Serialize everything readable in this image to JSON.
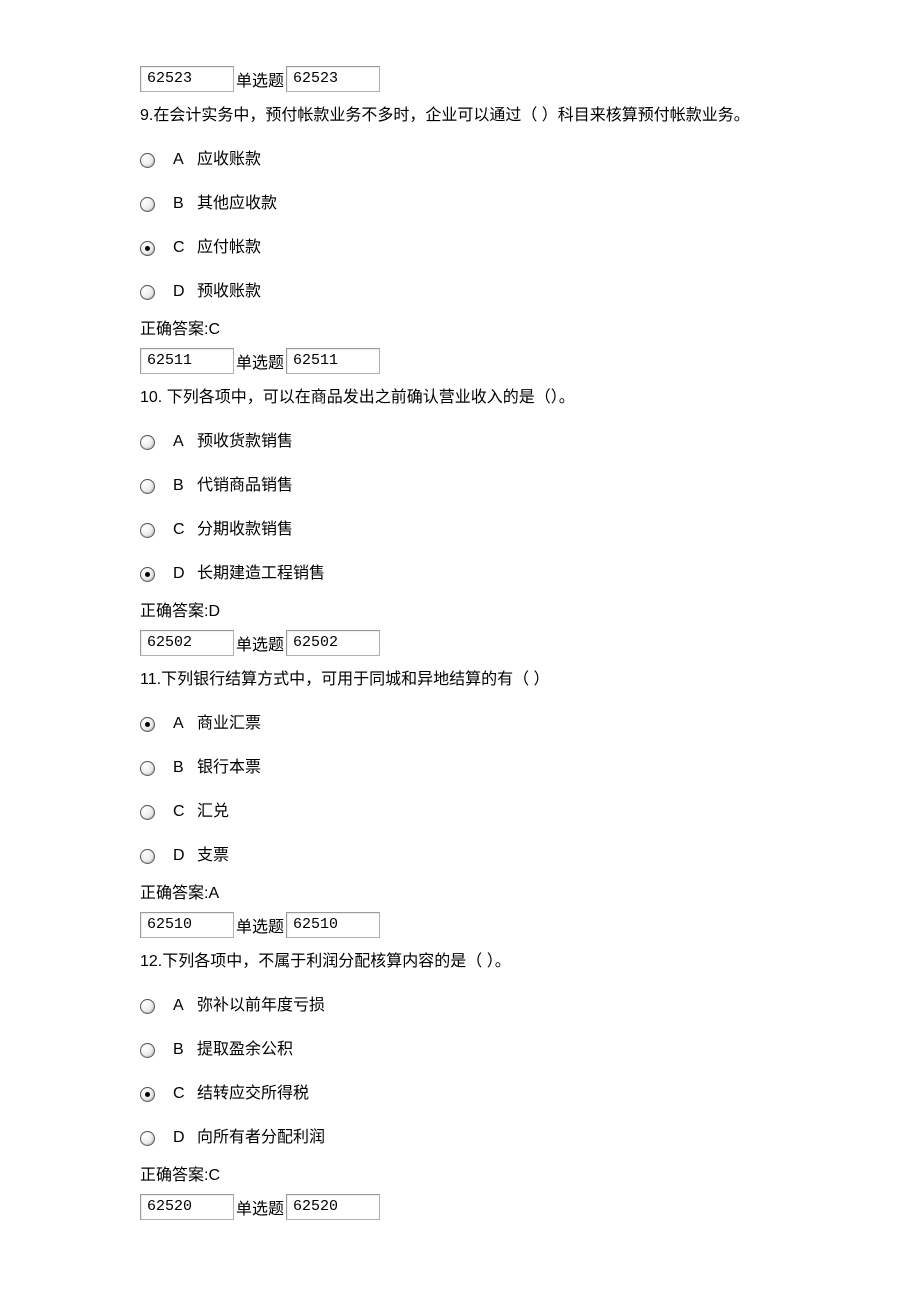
{
  "qtype_label": "单选题",
  "questions": [
    {
      "id1": "62523",
      "id2": "62523",
      "num": "9.",
      "stem": "在会计实务中，预付帐款业务不多时，企业可以通过（ ）科目来核算预付帐款业务。",
      "options": [
        {
          "label": "A",
          "text": "应收账款",
          "selected": false
        },
        {
          "label": "B",
          "text": "其他应收款",
          "selected": false
        },
        {
          "label": "C",
          "text": "应付帐款",
          "selected": true
        },
        {
          "label": "D",
          "text": "预收账款",
          "selected": false
        }
      ],
      "answer": "正确答案:C"
    },
    {
      "id1": "62511",
      "id2": "62511",
      "num": "10.",
      "stem": " 下列各项中，可以在商品发出之前确认营业收入的是（）。",
      "options": [
        {
          "label": "A",
          "text": "预收货款销售",
          "selected": false
        },
        {
          "label": "B",
          "text": "代销商品销售",
          "selected": false
        },
        {
          "label": "C",
          "text": "分期收款销售",
          "selected": false
        },
        {
          "label": "D",
          "text": "长期建造工程销售",
          "selected": true
        }
      ],
      "answer": "正确答案:D"
    },
    {
      "id1": "62502",
      "id2": "62502",
      "num": "11.",
      "stem": "下列银行结算方式中，可用于同城和异地结算的有（ ）",
      "options": [
        {
          "label": "A",
          "text": "商业汇票",
          "selected": true
        },
        {
          "label": "B",
          "text": "银行本票",
          "selected": false
        },
        {
          "label": "C",
          "text": "汇兑",
          "selected": false
        },
        {
          "label": "D",
          "text": "支票",
          "selected": false
        }
      ],
      "answer": "正确答案:A"
    },
    {
      "id1": "62510",
      "id2": "62510",
      "num": "12.",
      "stem": "下列各项中，不属于利润分配核算内容的是（ ）。",
      "options": [
        {
          "label": "A",
          "text": "弥补以前年度亏损",
          "selected": false
        },
        {
          "label": "B",
          "text": "提取盈余公积",
          "selected": false
        },
        {
          "label": "C",
          "text": "结转应交所得税",
          "selected": true
        },
        {
          "label": "D",
          "text": "向所有者分配利润",
          "selected": false
        }
      ],
      "answer": "正确答案:C"
    },
    {
      "id1": "62520",
      "id2": "62520",
      "trailing_only": true
    }
  ]
}
